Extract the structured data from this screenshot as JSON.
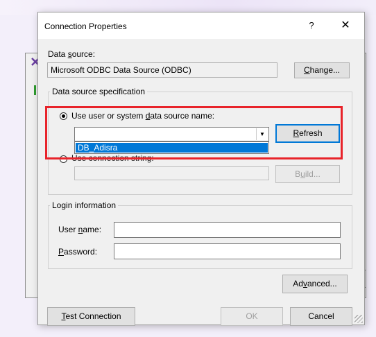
{
  "background_window": {
    "icon": "app-icon"
  },
  "dialog": {
    "title": "Connection Properties",
    "help": "?",
    "close": "✕"
  },
  "data_source": {
    "label_pre": "Data ",
    "label_key": "s",
    "label_post": "ource:",
    "value": "Microsoft ODBC Data Source (ODBC)",
    "change_key": "C",
    "change_post": "hange..."
  },
  "dss_group": {
    "title": "Data source specification",
    "radio1": {
      "pre": "Use user or system ",
      "key": "d",
      "post": "ata source name:",
      "checked": true
    },
    "dsn_value": "",
    "dropdown_arrow": "▼",
    "dropdown_items": [
      "DB_Adisra"
    ],
    "refresh_key": "R",
    "refresh_post": "efresh",
    "radio2_partial": "Use connection string:",
    "build_pre": "B",
    "build_key": "u",
    "build_post": "ild..."
  },
  "login": {
    "title": "Login information",
    "user_pre": "User ",
    "user_key": "n",
    "user_post": "ame:",
    "pass_key": "P",
    "pass_post": "assword:"
  },
  "buttons": {
    "advanced_pre": "Ad",
    "advanced_key": "v",
    "advanced_post": "anced...",
    "test_key": "T",
    "test_post": "est Connection",
    "ok": "OK",
    "cancel": "Cancel"
  },
  "colors": {
    "highlight": "#e8232a",
    "selection": "#0078d7"
  }
}
